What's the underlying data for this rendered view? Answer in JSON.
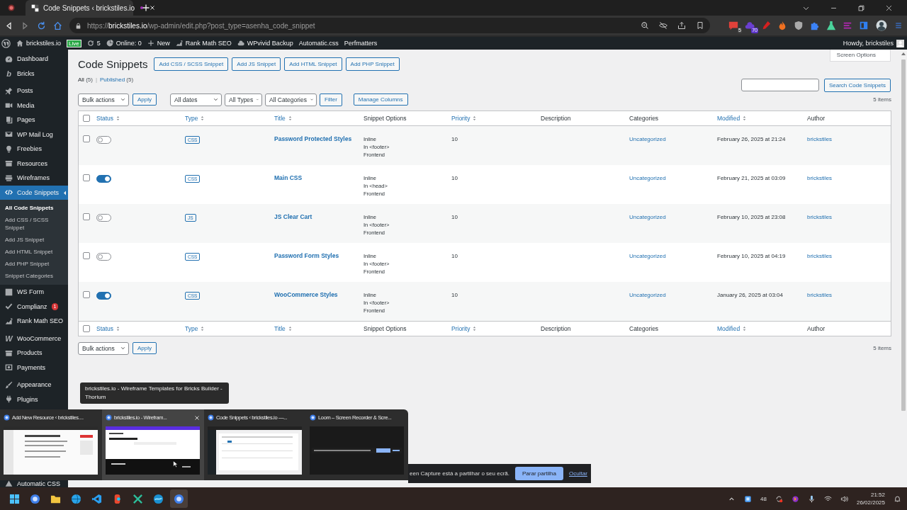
{
  "browser": {
    "tab": {
      "title": "Code Snippets ‹ brickstiles.io",
      "selected": true
    },
    "url": {
      "scheme": "https://",
      "host": "brickstiles.io",
      "path": "/wp-admin/edit.php?post_type=asenha_code_snippet"
    },
    "extensions": [
      {
        "kind": "notes",
        "badge": "5"
      },
      {
        "kind": "cloud",
        "badge": "70"
      },
      {
        "kind": "marker"
      },
      {
        "kind": "flame"
      },
      {
        "kind": "shield"
      },
      {
        "kind": "puzzle"
      },
      {
        "kind": "flask"
      },
      {
        "kind": "lines"
      },
      {
        "kind": "panel"
      }
    ]
  },
  "admin_bar": {
    "site": "brickstiles.io",
    "environment": "Live",
    "updates": "5",
    "online": "Online: 0",
    "new": "New",
    "links": [
      {
        "kind": "chart",
        "label": "Rank Math SEO"
      },
      {
        "kind": "cloud",
        "label": "WPvivid Backup"
      },
      {
        "kind": "none",
        "label": "Automatic.css"
      },
      {
        "kind": "none",
        "label": "Perfmatters"
      }
    ],
    "greeting": "Howdy, brickstiles"
  },
  "sidebar": {
    "groups": [
      [
        {
          "label": "Dashboard",
          "kind": "gauge",
          "selected": false
        },
        {
          "label": "Bricks",
          "kind": "glyph",
          "glyph": "b",
          "selected": false
        }
      ],
      [
        {
          "label": "Posts",
          "kind": "pin",
          "selected": false
        },
        {
          "label": "Media",
          "kind": "media",
          "selected": false
        },
        {
          "label": "Pages",
          "kind": "pages",
          "selected": false
        },
        {
          "label": "WP Mail Log",
          "kind": "mail",
          "selected": false
        },
        {
          "label": "Freebies",
          "kind": "bulb",
          "selected": false
        },
        {
          "label": "Resources",
          "kind": "box",
          "selected": false
        },
        {
          "label": "Wireframes",
          "kind": "layers",
          "selected": false
        },
        {
          "label": "Code Snippets",
          "kind": "code",
          "selected": true,
          "children": [
            {
              "label": "All Code Snippets",
              "selected": true
            },
            {
              "label": "Add CSS / SCSS Snippet",
              "selected": false
            },
            {
              "label": "Add JS Snippet",
              "selected": false
            },
            {
              "label": "Add HTML Snippet",
              "selected": false
            },
            {
              "label": "Add PHP Snippet",
              "selected": false
            },
            {
              "label": "Snippet Categories",
              "selected": false
            }
          ]
        },
        {
          "label": "WS Form",
          "kind": "form",
          "selected": false
        },
        {
          "label": "Complianz",
          "kind": "check",
          "selected": false,
          "badge": "1"
        },
        {
          "label": "Rank Math SEO",
          "kind": "chart",
          "selected": false
        }
      ],
      [
        {
          "label": "WooCommerce",
          "kind": "glyph",
          "glyph": "W",
          "selected": false
        },
        {
          "label": "Products",
          "kind": "box",
          "selected": false
        },
        {
          "label": "Payments",
          "kind": "dollar",
          "selected": false
        }
      ],
      [
        {
          "label": "Appearance",
          "kind": "brush",
          "selected": false
        },
        {
          "label": "Plugins",
          "kind": "plug",
          "selected": false
        }
      ],
      [
        {
          "label": "Automatic CSS",
          "kind": "triangle",
          "selected": false
        }
      ]
    ]
  },
  "page": {
    "title": "Code Snippets",
    "screen_options": "Screen Options",
    "add_buttons": [
      "Add CSS / SCSS Snippet",
      "Add JS Snippet",
      "Add HTML Snippet",
      "Add PHP Snippet"
    ],
    "views": [
      {
        "label": "All",
        "count": "(5)",
        "selected": true
      },
      {
        "separator": "|",
        "label": "Published",
        "count": "(5)",
        "selected": false
      }
    ],
    "search_button": "Search Code Snippets",
    "top_nav": {
      "bulk": "Bulk actions",
      "apply": "Apply",
      "filters": [
        "All dates",
        "All Types",
        "All Categories"
      ],
      "filter": "Filter",
      "manage": "Manage Columns",
      "count": "5 items"
    },
    "table": {
      "header_checked": false,
      "columns": [
        {
          "label": "Status",
          "sortable": true
        },
        {
          "label": "Type",
          "sortable": true
        },
        {
          "label": "Title",
          "sortable": true
        },
        {
          "label": "Snippet Options",
          "sortable": false
        },
        {
          "label": "Priority",
          "sortable": true
        },
        {
          "label": "Description",
          "sortable": false
        },
        {
          "label": "Categories",
          "sortable": false
        },
        {
          "label": "Modified",
          "sortable": true
        },
        {
          "label": "Author",
          "sortable": false
        }
      ],
      "rows": [
        {
          "selected": false,
          "enabled": false,
          "type": "CSS",
          "title": "Password Protected Styles",
          "options": [
            "Inline",
            "In <footer>",
            "Frontend"
          ],
          "priority": "10",
          "category": "Uncategorized",
          "modified": "February 26, 2025 at 21:24",
          "author": "brickstiles"
        },
        {
          "selected": false,
          "enabled": true,
          "type": "CSS",
          "title": "Main CSS",
          "options": [
            "Inline",
            "In <head>",
            "Frontend"
          ],
          "priority": "10",
          "category": "Uncategorized",
          "modified": "February 21, 2025 at 03:09",
          "author": "brickstiles"
        },
        {
          "selected": false,
          "enabled": false,
          "type": "JS",
          "title": "JS Clear Cart",
          "options": [
            "Inline",
            "In <footer>",
            "Frontend"
          ],
          "priority": "10",
          "category": "Uncategorized",
          "modified": "February 10, 2025 at 23:08",
          "author": "brickstiles"
        },
        {
          "selected": false,
          "enabled": false,
          "type": "CSS",
          "title": "Password Form Styles",
          "options": [
            "Inline",
            "In <footer>",
            "Frontend"
          ],
          "priority": "10",
          "category": "Uncategorized",
          "modified": "February 10, 2025 at 04:19",
          "author": "brickstiles"
        },
        {
          "selected": false,
          "enabled": true,
          "type": "CSS",
          "title": "WooCommerce Styles",
          "options": [
            "Inline",
            "In <footer>",
            "Frontend"
          ],
          "priority": "10",
          "category": "Uncategorized",
          "modified": "January 26, 2025 at 03:04",
          "author": "brickstiles"
        }
      ],
      "footer_checked": false,
      "footer_columns": [
        {
          "label": "Status",
          "sortable": true
        },
        {
          "label": "Type",
          "sortable": true
        },
        {
          "label": "Title",
          "sortable": true
        },
        {
          "label": "Snippet Options",
          "sortable": false
        },
        {
          "label": "Priority",
          "sortable": true
        },
        {
          "label": "Description",
          "sortable": false
        },
        {
          "label": "Categories",
          "sortable": false
        },
        {
          "label": "Modified",
          "sortable": true
        },
        {
          "label": "Author",
          "sortable": false
        }
      ]
    },
    "bottom_nav": {
      "bulk": "Bulk actions",
      "apply": "Apply",
      "count": "5 items"
    }
  },
  "window_previews": {
    "tooltip": "brickstiles.io - Wireframe Templates for Bricks Builder - Thorium",
    "windows": [
      {
        "title": "Add New Resource ‹ brickstiles....",
        "hovered": false,
        "kind": "picture"
      },
      {
        "title": "brickstiles.io - Wirefram...",
        "hovered": true,
        "kind": "picture"
      },
      {
        "title": "Code Snippets ‹ brickstiles.io —...",
        "hovered": false,
        "kind": "picture"
      },
      {
        "title": "Loom – Screen Recorder & Scre...",
        "hovered": false,
        "kind": "picture"
      }
    ]
  },
  "share_bar": {
    "message": "een Capture está a partilhar o seu ecrã.",
    "stop": "Parar partilha",
    "hide": "Ocultar"
  },
  "taskbar": {
    "apps": [
      {
        "kind": "start",
        "active": false
      },
      {
        "kind": "browser",
        "active": false
      },
      {
        "kind": "folder",
        "active": false
      },
      {
        "kind": "globe",
        "active": false
      },
      {
        "kind": "code",
        "active": false
      },
      {
        "kind": "design",
        "active": false
      },
      {
        "kind": "cross",
        "active": false
      },
      {
        "kind": "wave",
        "active": false
      },
      {
        "kind": "browser",
        "active": true
      }
    ],
    "tray": {
      "weather": "48",
      "time": "21:52",
      "date": "26/02/2025"
    }
  }
}
